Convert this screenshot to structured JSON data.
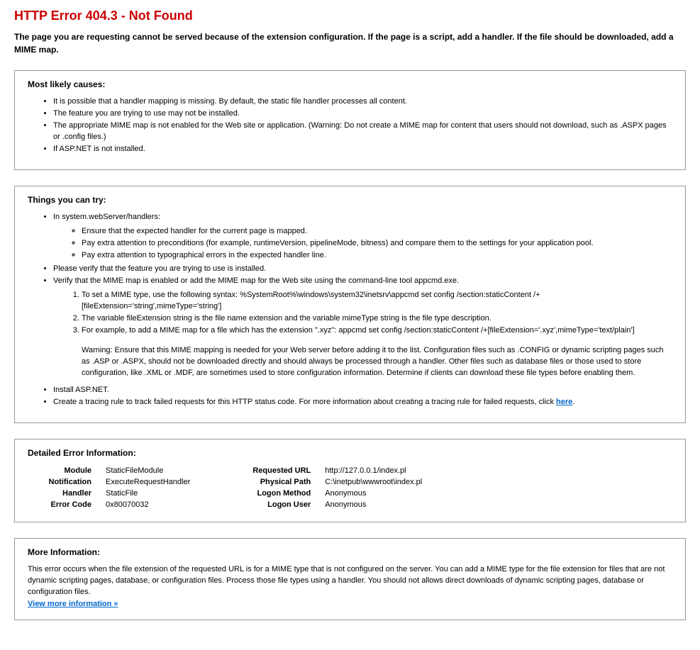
{
  "title": "HTTP Error 404.3 - Not Found",
  "subtitle": "The page you are requesting cannot be served because of the extension configuration. If the page is a script, add a handler. If the file should be downloaded, add a MIME map.",
  "causes": {
    "heading": "Most likely causes:",
    "items": [
      "It is possible that a handler mapping is missing. By default, the static file handler processes all content.",
      "The feature you are trying to use may not be installed.",
      "The appropriate MIME map is not enabled for the Web site or application. (Warning: Do not create a MIME map for content that users should not download, such as .ASPX pages or .config files.)",
      "If ASP.NET is not installed."
    ]
  },
  "try": {
    "heading": "Things you can try:",
    "item1": "In system.webServer/handlers:",
    "sub1": [
      "Ensure that the expected handler for the current page is mapped.",
      "Pay extra attention to preconditions (for example, runtimeVersion, pipelineMode, bitness) and compare them to the settings for your application pool.",
      "Pay extra attention to typographical errors in the expected handler line."
    ],
    "item2": "Please verify that the feature you are trying to use is installed.",
    "item3": "Verify that the MIME map is enabled or add the MIME map for the Web site using the command-line tool appcmd.exe.",
    "ol": [
      "To set a MIME type, use the following syntax: %SystemRoot%\\windows\\system32\\inetsrv\\appcmd set config /section:staticContent /+[fileExtension='string',mimeType='string']",
      "The variable fileExtension string is the file name extension and the variable mimeType string is the file type description.",
      "For example, to add a MIME map for a file which has the extension \".xyz\": appcmd set config /section:staticContent /+[fileExtension='.xyz',mimeType='text/plain']"
    ],
    "warn": "Warning: Ensure that this MIME mapping is needed for your Web server before adding it to the list. Configuration files such as .CONFIG or dynamic scripting pages such as .ASP or .ASPX, should not be downloaded directly and should always be processed through a handler. Other files such as database files or those used to store configuration, like .XML or .MDF, are sometimes used to store configuration information. Determine if clients can download these file types before enabling them.",
    "item4": "Install ASP.NET.",
    "item5_pre": "Create a tracing rule to track failed requests for this HTTP status code. For more information about creating a tracing rule for failed requests, click ",
    "item5_link": "here",
    "item5_post": "."
  },
  "details": {
    "heading": "Detailed Error Information:",
    "left": [
      {
        "label": "Module",
        "value": "StaticFileModule"
      },
      {
        "label": "Notification",
        "value": "ExecuteRequestHandler"
      },
      {
        "label": "Handler",
        "value": "StaticFile"
      },
      {
        "label": "Error Code",
        "value": "0x80070032"
      }
    ],
    "right": [
      {
        "label": "Requested URL",
        "value": "http://127.0.0.1/index.pl"
      },
      {
        "label": "Physical Path",
        "value": "C:\\inetpub\\wwwroot\\index.pl"
      },
      {
        "label": "Logon Method",
        "value": "Anonymous"
      },
      {
        "label": "Logon User",
        "value": "Anonymous"
      }
    ]
  },
  "more": {
    "heading": "More Information:",
    "text": "This error occurs when the file extension of the requested URL is for a MIME type that is not configured on the server. You can add a MIME type for the file extension for files that are not dynamic scripting pages, database, or configuration files. Process those file types using a handler. You should not allows direct downloads of dynamic scripting pages, database or configuration files.",
    "link": "View more information »"
  }
}
